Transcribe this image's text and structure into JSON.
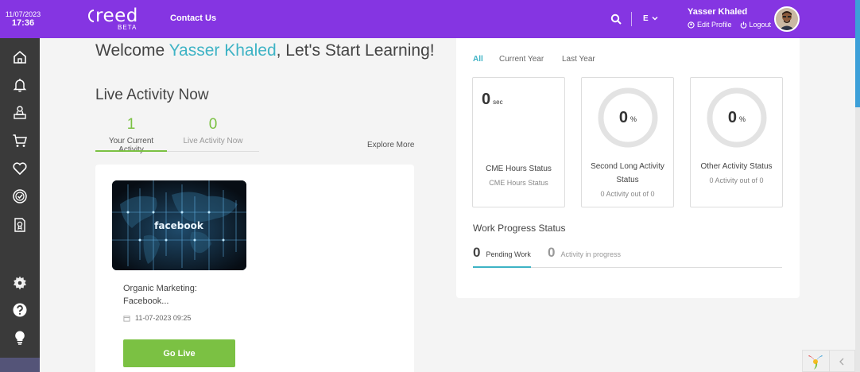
{
  "datetime": {
    "date": "11/07/2023",
    "time": "17:36"
  },
  "logo": {
    "word": "reed",
    "beta": "BETA"
  },
  "nav": {
    "contact": "Contact Us"
  },
  "lang": {
    "label": "E"
  },
  "user": {
    "name": "Yasser Khaled",
    "edit_profile": "Edit Profile",
    "logout": "Logout"
  },
  "sidebar": {
    "items": [
      {
        "icon": "home-icon"
      },
      {
        "icon": "bell-icon"
      },
      {
        "icon": "award-icon"
      },
      {
        "icon": "cart-icon"
      },
      {
        "icon": "heart-icon"
      },
      {
        "icon": "check-badge-icon"
      },
      {
        "icon": "certificate-icon"
      },
      {
        "icon": "gear-icon"
      },
      {
        "icon": "help-icon"
      },
      {
        "icon": "lightbulb-icon"
      }
    ]
  },
  "welcome": {
    "prefix": "Welcome ",
    "name": "Yasser Khaled",
    "suffix": ", Let's Start Learning!"
  },
  "live": {
    "title": "Live Activity Now",
    "tabs": [
      {
        "count": "1",
        "label": "Your Current Activity"
      },
      {
        "count": "0",
        "label": "Live Activity Now"
      }
    ],
    "explore": "Explore More"
  },
  "activity": {
    "thumb_text": "facebook",
    "title": "Organic Marketing: Facebook...",
    "date": "11-07-2023 09:25",
    "button": "Go Live"
  },
  "stats": {
    "periods": [
      "All",
      "Current Year",
      "Last Year"
    ],
    "cme": {
      "value": "0",
      "unit": "sec",
      "title": "CME Hours Status",
      "sub": "CME Hours Status"
    },
    "second": {
      "value": "0",
      "unit": "%",
      "title": "Second Long Activity Status",
      "sub": "0 Activity out of 0"
    },
    "other": {
      "value": "0",
      "unit": "%",
      "title": "Other Activity Status",
      "sub": "0 Activity out of 0"
    }
  },
  "work": {
    "title": "Work Progress Status",
    "tabs": [
      {
        "count": "0",
        "label": "Pending Work"
      },
      {
        "count": "0",
        "label": "Activity in progress"
      }
    ]
  },
  "colors": {
    "header": "#8535e2",
    "accent": "#3eb3c5",
    "green": "#7bc143",
    "sidebar": "#3a3a3a"
  }
}
